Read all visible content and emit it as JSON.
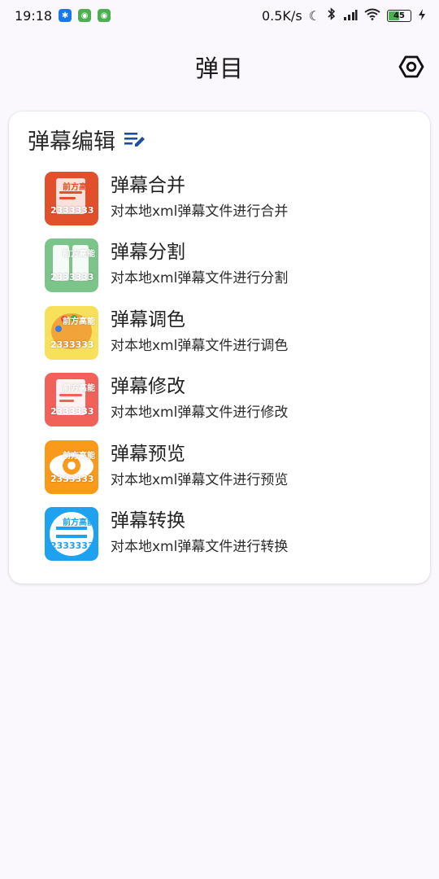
{
  "status": {
    "time": "19:18",
    "net_speed": "0.5K/s",
    "battery": "45"
  },
  "app_bar": {
    "title": "弹目",
    "settings_icon": "settings-hexagon-icon"
  },
  "section": {
    "title": "弹幕编辑",
    "icon": "edit-list-icon",
    "items": [
      {
        "title": "弹幕合并",
        "subtitle": "对本地xml弹幕文件进行合并",
        "icon": "merge-danmaku-icon",
        "color": "#e24f2b",
        "icon_top_label": "前方高能",
        "icon_bottom_label": "2333333"
      },
      {
        "title": "弹幕分割",
        "subtitle": "对本地xml弹幕文件进行分割",
        "icon": "split-danmaku-icon",
        "color": "#7dc48a",
        "icon_top_label": "前方高能",
        "icon_bottom_label": "2333333"
      },
      {
        "title": "弹幕调色",
        "subtitle": "对本地xml弹幕文件进行调色",
        "icon": "color-danmaku-icon",
        "color": "#f7e15a",
        "icon_top_label": "前方高能",
        "icon_bottom_label": "2333333"
      },
      {
        "title": "弹幕修改",
        "subtitle": "对本地xml弹幕文件进行修改",
        "icon": "edit-danmaku-icon",
        "color": "#f2605a",
        "icon_top_label": "前方高能",
        "icon_bottom_label": "2333333"
      },
      {
        "title": "弹幕预览",
        "subtitle": "对本地xml弹幕文件进行预览",
        "icon": "preview-danmaku-icon",
        "color": "#f99a1a",
        "icon_top_label": "前方高能",
        "icon_bottom_label": "2333333"
      },
      {
        "title": "弹幕转换",
        "subtitle": "对本地xml弹幕文件进行转换",
        "icon": "convert-danmaku-icon",
        "color": "#1ea1ee",
        "icon_top_label": "前方高能",
        "icon_bottom_label": "2333333"
      }
    ]
  }
}
